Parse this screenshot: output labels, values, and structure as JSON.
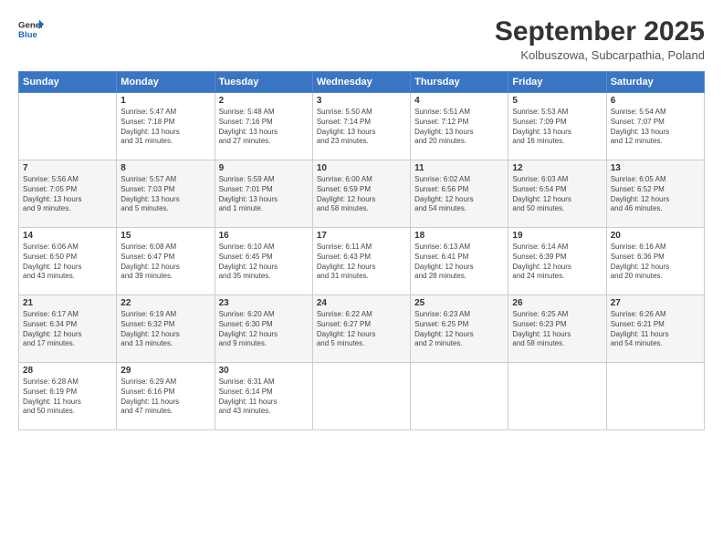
{
  "header": {
    "logo_line1": "General",
    "logo_line2": "Blue",
    "month": "September 2025",
    "location": "Kolbuszowa, Subcarpathia, Poland"
  },
  "days_of_week": [
    "Sunday",
    "Monday",
    "Tuesday",
    "Wednesday",
    "Thursday",
    "Friday",
    "Saturday"
  ],
  "weeks": [
    [
      {
        "day": "",
        "text": ""
      },
      {
        "day": "1",
        "text": "Sunrise: 5:47 AM\nSunset: 7:18 PM\nDaylight: 13 hours\nand 31 minutes."
      },
      {
        "day": "2",
        "text": "Sunrise: 5:48 AM\nSunset: 7:16 PM\nDaylight: 13 hours\nand 27 minutes."
      },
      {
        "day": "3",
        "text": "Sunrise: 5:50 AM\nSunset: 7:14 PM\nDaylight: 13 hours\nand 23 minutes."
      },
      {
        "day": "4",
        "text": "Sunrise: 5:51 AM\nSunset: 7:12 PM\nDaylight: 13 hours\nand 20 minutes."
      },
      {
        "day": "5",
        "text": "Sunrise: 5:53 AM\nSunset: 7:09 PM\nDaylight: 13 hours\nand 16 minutes."
      },
      {
        "day": "6",
        "text": "Sunrise: 5:54 AM\nSunset: 7:07 PM\nDaylight: 13 hours\nand 12 minutes."
      }
    ],
    [
      {
        "day": "7",
        "text": "Sunrise: 5:56 AM\nSunset: 7:05 PM\nDaylight: 13 hours\nand 9 minutes."
      },
      {
        "day": "8",
        "text": "Sunrise: 5:57 AM\nSunset: 7:03 PM\nDaylight: 13 hours\nand 5 minutes."
      },
      {
        "day": "9",
        "text": "Sunrise: 5:59 AM\nSunset: 7:01 PM\nDaylight: 13 hours\nand 1 minute."
      },
      {
        "day": "10",
        "text": "Sunrise: 6:00 AM\nSunset: 6:59 PM\nDaylight: 12 hours\nand 58 minutes."
      },
      {
        "day": "11",
        "text": "Sunrise: 6:02 AM\nSunset: 6:56 PM\nDaylight: 12 hours\nand 54 minutes."
      },
      {
        "day": "12",
        "text": "Sunrise: 6:03 AM\nSunset: 6:54 PM\nDaylight: 12 hours\nand 50 minutes."
      },
      {
        "day": "13",
        "text": "Sunrise: 6:05 AM\nSunset: 6:52 PM\nDaylight: 12 hours\nand 46 minutes."
      }
    ],
    [
      {
        "day": "14",
        "text": "Sunrise: 6:06 AM\nSunset: 6:50 PM\nDaylight: 12 hours\nand 43 minutes."
      },
      {
        "day": "15",
        "text": "Sunrise: 6:08 AM\nSunset: 6:47 PM\nDaylight: 12 hours\nand 39 minutes."
      },
      {
        "day": "16",
        "text": "Sunrise: 6:10 AM\nSunset: 6:45 PM\nDaylight: 12 hours\nand 35 minutes."
      },
      {
        "day": "17",
        "text": "Sunrise: 6:11 AM\nSunset: 6:43 PM\nDaylight: 12 hours\nand 31 minutes."
      },
      {
        "day": "18",
        "text": "Sunrise: 6:13 AM\nSunset: 6:41 PM\nDaylight: 12 hours\nand 28 minutes."
      },
      {
        "day": "19",
        "text": "Sunrise: 6:14 AM\nSunset: 6:39 PM\nDaylight: 12 hours\nand 24 minutes."
      },
      {
        "day": "20",
        "text": "Sunrise: 6:16 AM\nSunset: 6:36 PM\nDaylight: 12 hours\nand 20 minutes."
      }
    ],
    [
      {
        "day": "21",
        "text": "Sunrise: 6:17 AM\nSunset: 6:34 PM\nDaylight: 12 hours\nand 17 minutes."
      },
      {
        "day": "22",
        "text": "Sunrise: 6:19 AM\nSunset: 6:32 PM\nDaylight: 12 hours\nand 13 minutes."
      },
      {
        "day": "23",
        "text": "Sunrise: 6:20 AM\nSunset: 6:30 PM\nDaylight: 12 hours\nand 9 minutes."
      },
      {
        "day": "24",
        "text": "Sunrise: 6:22 AM\nSunset: 6:27 PM\nDaylight: 12 hours\nand 5 minutes."
      },
      {
        "day": "25",
        "text": "Sunrise: 6:23 AM\nSunset: 6:25 PM\nDaylight: 12 hours\nand 2 minutes."
      },
      {
        "day": "26",
        "text": "Sunrise: 6:25 AM\nSunset: 6:23 PM\nDaylight: 11 hours\nand 58 minutes."
      },
      {
        "day": "27",
        "text": "Sunrise: 6:26 AM\nSunset: 6:21 PM\nDaylight: 11 hours\nand 54 minutes."
      }
    ],
    [
      {
        "day": "28",
        "text": "Sunrise: 6:28 AM\nSunset: 6:19 PM\nDaylight: 11 hours\nand 50 minutes."
      },
      {
        "day": "29",
        "text": "Sunrise: 6:29 AM\nSunset: 6:16 PM\nDaylight: 11 hours\nand 47 minutes."
      },
      {
        "day": "30",
        "text": "Sunrise: 6:31 AM\nSunset: 6:14 PM\nDaylight: 11 hours\nand 43 minutes."
      },
      {
        "day": "",
        "text": ""
      },
      {
        "day": "",
        "text": ""
      },
      {
        "day": "",
        "text": ""
      },
      {
        "day": "",
        "text": ""
      }
    ]
  ]
}
